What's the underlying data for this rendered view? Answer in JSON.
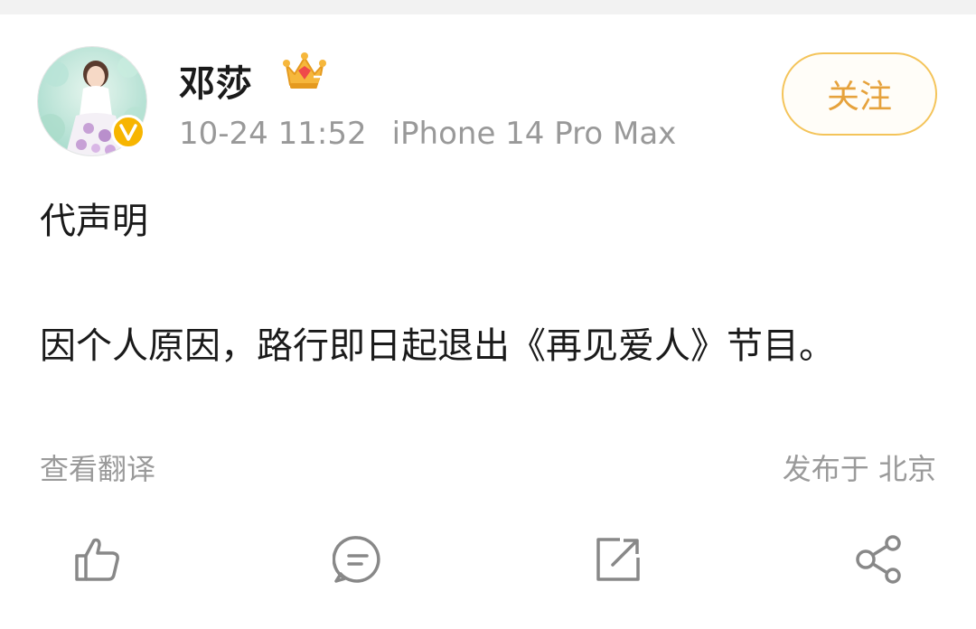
{
  "post": {
    "author": "邓莎",
    "time": "10-24 11:52",
    "device": "iPhone 14 Pro Max",
    "follow_label": "关注",
    "line1": "代声明",
    "line2": "因个人原因，路行即日起退出《再见爱人》节目。",
    "translate_label": "查看翻译",
    "location_prefix": "发布于",
    "location": "北京"
  },
  "icons": {
    "like": "thumbs-up-icon",
    "comment": "comment-icon",
    "repost": "repost-icon",
    "share": "share-icon",
    "verified": "verified-v-icon",
    "vip": "crown-icon"
  },
  "colors": {
    "accent": "#e6a23c",
    "badge": "#f7b500",
    "meta_text": "#999999"
  }
}
